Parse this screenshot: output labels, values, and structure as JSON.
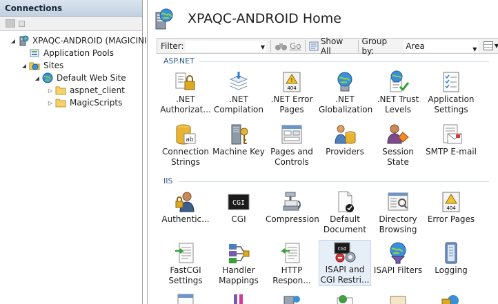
{
  "connections": {
    "header": "Connections",
    "tree": [
      {
        "label": "XPAQC-ANDROID (MAGICINI",
        "expander": "◢",
        "icon": "server-icon"
      },
      {
        "label": "Application Pools",
        "expander": "",
        "icon": "app-pools-icon"
      },
      {
        "label": "Sites",
        "expander": "◢",
        "icon": "sites-folder-icon"
      },
      {
        "label": "Default Web Site",
        "expander": "◢",
        "icon": "globe-icon"
      },
      {
        "label": "aspnet_client",
        "expander": "▷",
        "icon": "folder-icon"
      },
      {
        "label": "MagicScripts",
        "expander": "▷",
        "icon": "folder-icon"
      }
    ]
  },
  "main": {
    "title": "XPAQC-ANDROID Home",
    "filter": {
      "label": "Filter:",
      "value": "",
      "go_label": "Go",
      "show_all_label": "Show All",
      "group_by_label": "Group by:",
      "group_by_value": "Area"
    },
    "sections": [
      {
        "name": "ASP.NET",
        "features": [
          {
            "label": ".NET Authorizat...",
            "icon": "lock-people-icon"
          },
          {
            "label": ".NET Compilation",
            "icon": "compilation-stack-icon"
          },
          {
            "label": ".NET Error Pages",
            "icon": "warning-404-icon"
          },
          {
            "label": ".NET Globalization",
            "icon": "globe-server-icon"
          },
          {
            "label": ".NET Trust Levels",
            "icon": "trust-check-icon"
          },
          {
            "label": "Application Settings",
            "icon": "settings-checklist-icon"
          },
          {
            "label": "Connection Strings",
            "icon": "database-ab-icon"
          },
          {
            "label": "Machine Key",
            "icon": "machine-key-icon"
          },
          {
            "label": "Pages and Controls",
            "icon": "pages-controls-icon"
          },
          {
            "label": "Providers",
            "icon": "providers-icon"
          },
          {
            "label": "Session State",
            "icon": "session-state-icon"
          },
          {
            "label": "SMTP E-mail",
            "icon": "smtp-email-icon"
          }
        ]
      },
      {
        "name": "IIS",
        "features": [
          {
            "label": "Authentic...",
            "icon": "authentication-icon"
          },
          {
            "label": "CGI",
            "icon": "cgi-icon",
            "text": "CGI"
          },
          {
            "label": "Compression",
            "icon": "compression-clamp-icon"
          },
          {
            "label": "Default Document",
            "icon": "default-document-icon"
          },
          {
            "label": "Directory Browsing",
            "icon": "directory-browsing-icon"
          },
          {
            "label": "Error Pages",
            "icon": "error-404-icon",
            "text": "404"
          },
          {
            "label": "FastCGI Settings",
            "icon": "fastcgi-icon"
          },
          {
            "label": "Handler Mappings",
            "icon": "handler-mappings-icon"
          },
          {
            "label": "HTTP Respon...",
            "icon": "http-response-icon"
          },
          {
            "label": "ISAPI and CGI Restri...",
            "icon": "isapi-cgi-icon",
            "selected": true
          },
          {
            "label": "ISAPI Filters",
            "icon": "isapi-filters-icon"
          },
          {
            "label": "Logging",
            "icon": "logging-icon"
          }
        ]
      }
    ]
  },
  "colors": {
    "header_bg": "#c9d7e5",
    "section_text": "#2a5a8a",
    "selected_bg": "#e6eef8"
  }
}
